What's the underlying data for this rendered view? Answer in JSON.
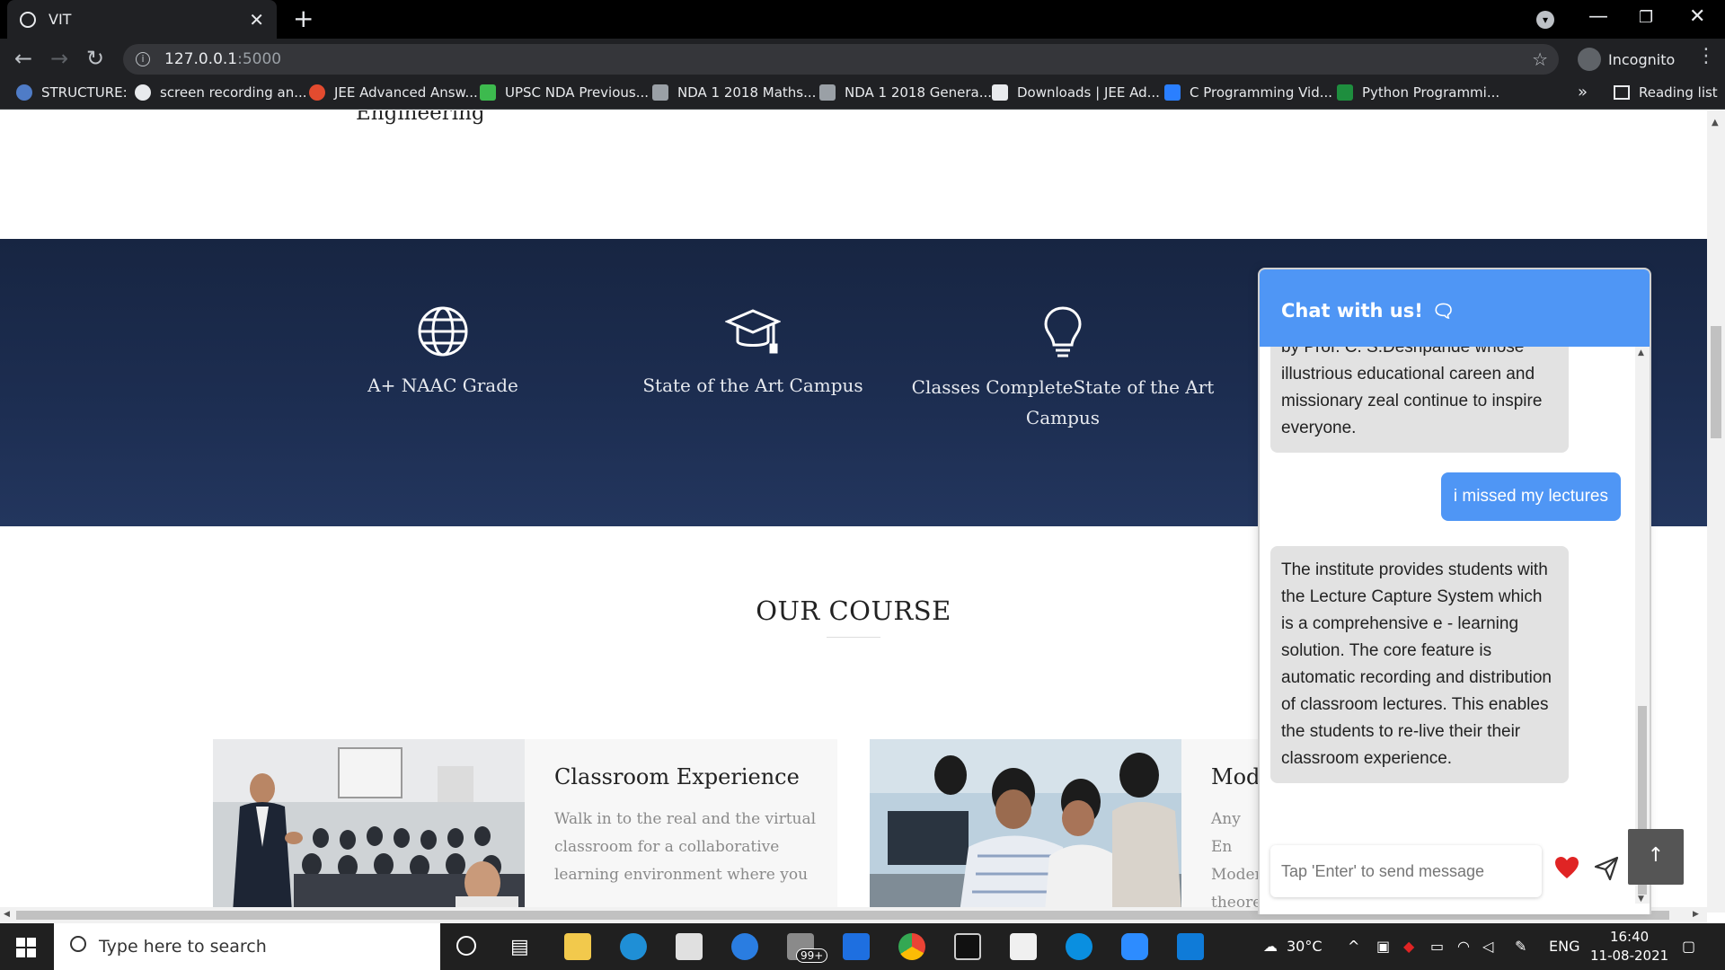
{
  "browser": {
    "tab_title": "VIT",
    "tab_close": "✕",
    "new_tab": "+",
    "address_host": "127.0.0.1",
    "address_port": ":5000",
    "profile_label": "Incognito",
    "bookmarks": [
      {
        "label": "STRUCTURE:",
        "color": "#4f7cc7"
      },
      {
        "label": "screen recording an...",
        "color": "#e8eaed"
      },
      {
        "label": "JEE Advanced Answ...",
        "color": "#e34b2f"
      },
      {
        "label": "UPSC NDA Previous...",
        "color": "#3dba4e"
      },
      {
        "label": "NDA 1 2018 Maths...",
        "color": "#9aa0a6"
      },
      {
        "label": "NDA 1 2018 Genera...",
        "color": "#9aa0a6"
      },
      {
        "label": "Downloads | JEE Ad...",
        "color": "#e8eaed"
      },
      {
        "label": "C Programming Vid...",
        "color": "#2a7fff"
      },
      {
        "label": "Python Programmi...",
        "color": "#1e8e3e"
      }
    ],
    "bookmarks_more": "»",
    "reading_list": "Reading list"
  },
  "page": {
    "cut_heading": "Engineering",
    "features": [
      {
        "icon": "globe-icon",
        "label": "A+ NAAC Grade"
      },
      {
        "icon": "graduation-cap-icon",
        "label": "State of the Art Campus"
      },
      {
        "icon": "lightbulb-icon",
        "label": "Classes CompleteState of the Art Campus"
      }
    ],
    "section_title": "OUR COURSE",
    "courses": [
      {
        "title": "Classroom Experience",
        "text": "Walk in to the real and the virtual classroom for a collaborative learning environment where you"
      },
      {
        "title": "Mode",
        "text": "Any En Moder theore"
      }
    ]
  },
  "chat": {
    "header": "Chat with us!",
    "messages": [
      {
        "from": "bot",
        "text": "by Prof. C. S.Deshpande whose illustrious educational careen and missionary zeal continue to inspire everyone."
      },
      {
        "from": "user",
        "text": "i missed my lectures"
      },
      {
        "from": "bot",
        "text": "The institute provides students with the Lecture Capture System which is a comprehensive e - learning solution. The core feature is automatic recording and distribution of classroom lectures. This enables the students to re-live their their classroom experience."
      }
    ],
    "input_placeholder": "Tap 'Enter' to send message",
    "to_top": "↑"
  },
  "taskbar": {
    "search_placeholder": "Type here to search",
    "mail_badge": "99+",
    "weather": "30°C",
    "language": "ENG",
    "time": "16:40",
    "date": "11-08-2021"
  }
}
